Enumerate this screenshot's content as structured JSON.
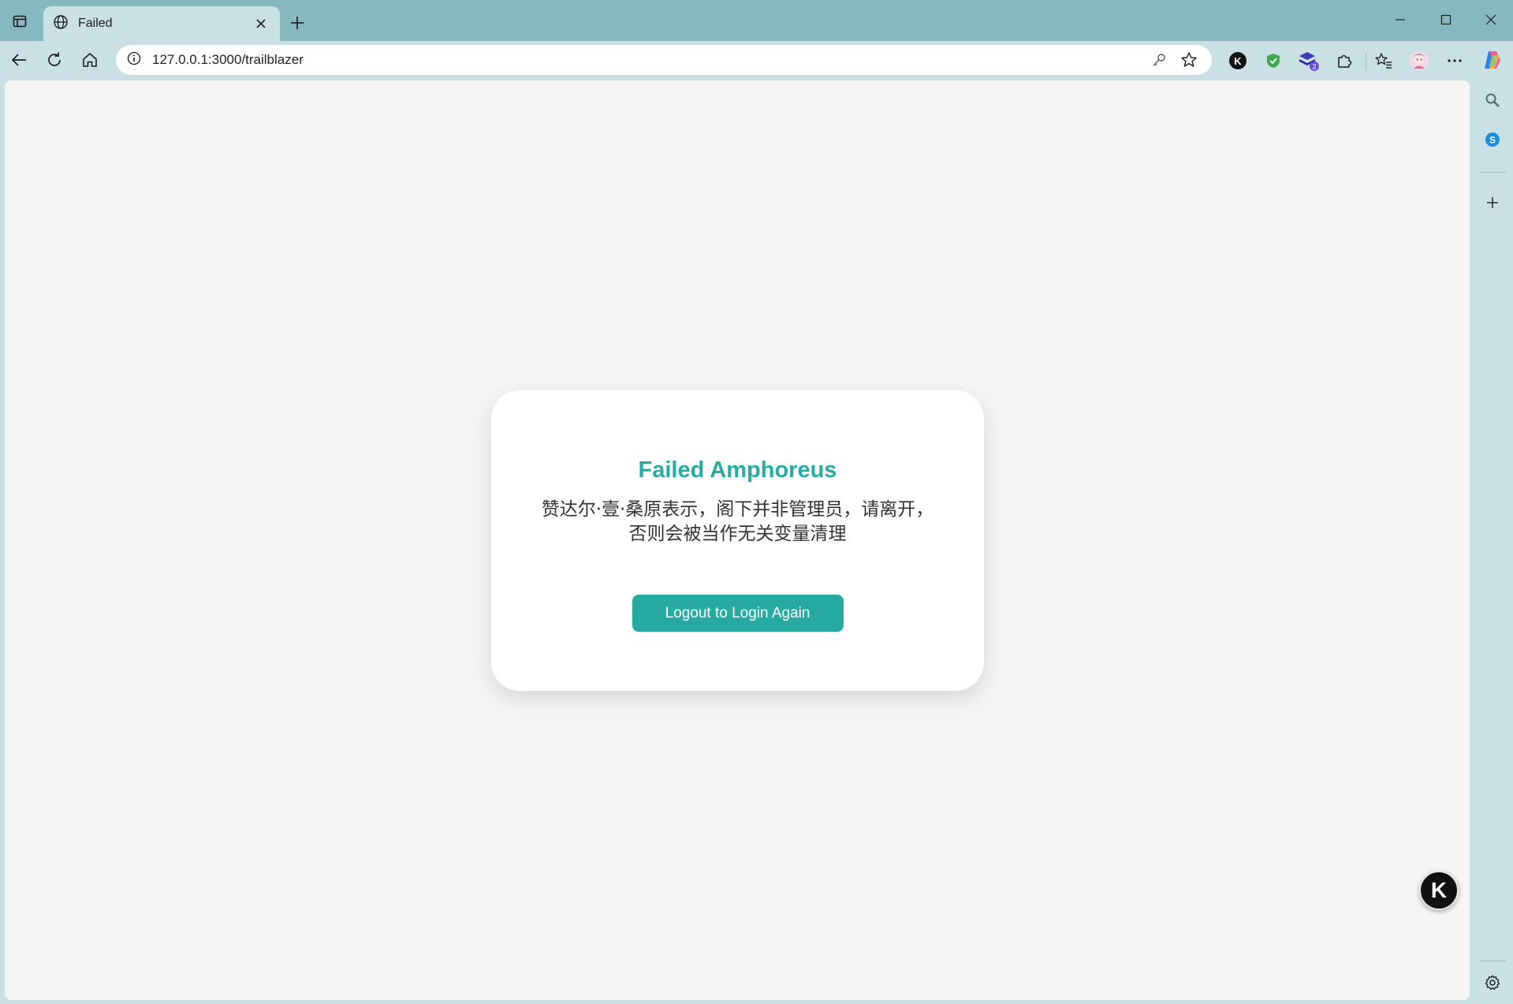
{
  "browser": {
    "tab": {
      "title": "Failed"
    },
    "address_bar": {
      "url": "127.0.0.1:3000/trailblazer"
    },
    "extensions": [
      {
        "name": "k-extension-icon",
        "label": "K"
      },
      {
        "name": "shield-extension-icon"
      },
      {
        "name": "stack-extension-icon",
        "badge": "2"
      },
      {
        "name": "puzzle-extensions-icon"
      }
    ],
    "accent": "#86b8c0"
  },
  "page": {
    "title": "Failed Amphoreus",
    "message": "赞达尔·壹·桑原表示，阁下并非管理员，请离开，否则会被当作无关变量清理",
    "logout_button": "Logout to Login Again",
    "floating_widget": "K",
    "colors": {
      "accent": "#26aaa1",
      "background": "#f4f4f4",
      "card": "#ffffff"
    }
  }
}
